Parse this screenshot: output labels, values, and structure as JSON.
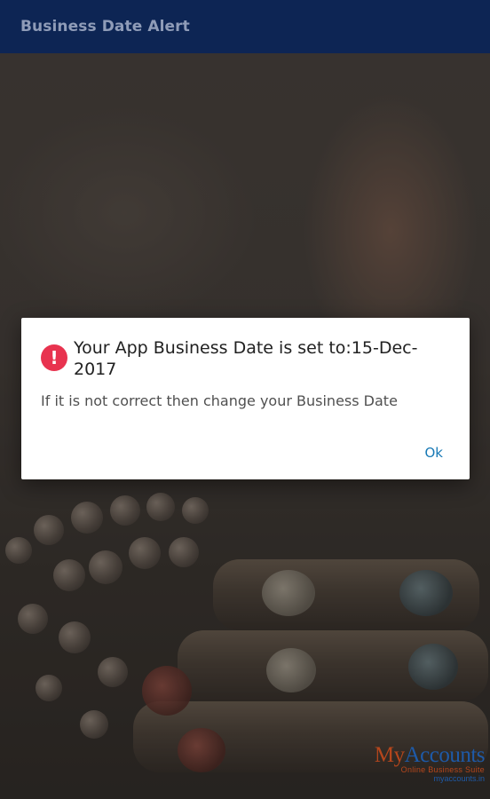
{
  "appbar": {
    "title": "Business Date Alert"
  },
  "dialog": {
    "icon": "alert-circle-icon",
    "icon_glyph": "!",
    "icon_color": "#e8334f",
    "title": "Your App Business Date is set to:15-Dec-2017",
    "message": "If it is not correct then change your Business Date",
    "ok_label": "Ok",
    "button_color": "#1779b5"
  },
  "watermark": {
    "brand_part1": "My",
    "brand_part2": "Accounts",
    "tagline": "Online Business Suite",
    "url": "myaccounts.in"
  },
  "colors": {
    "appbar_bg": "#0d2554",
    "appbar_text": "#8f9cb8"
  }
}
